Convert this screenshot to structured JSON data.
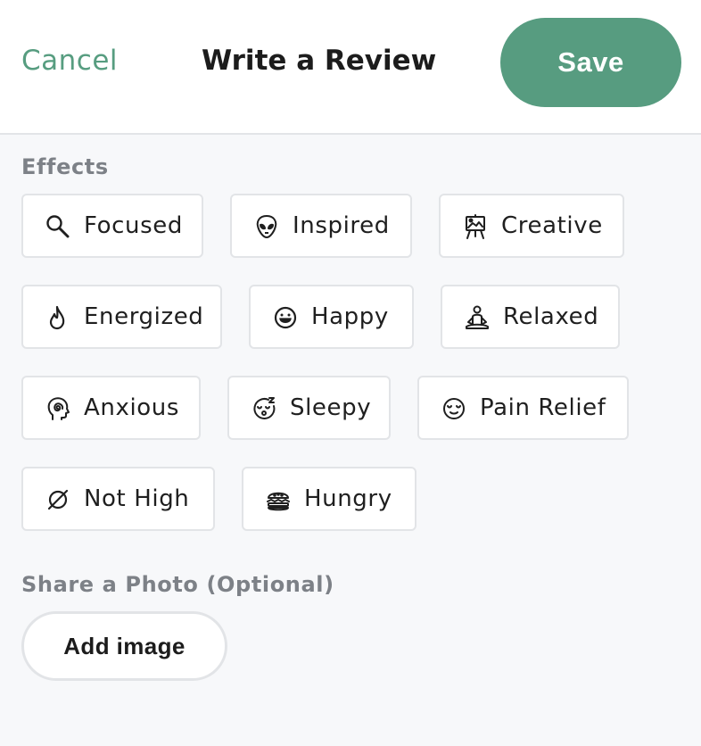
{
  "header": {
    "cancel_label": "Cancel",
    "title": "Write a Review",
    "save_label": "Save"
  },
  "effects": {
    "label": "Effects",
    "items": [
      {
        "label": "Focused",
        "icon": "magnifier-icon"
      },
      {
        "label": "Inspired",
        "icon": "alien-icon"
      },
      {
        "label": "Creative",
        "icon": "easel-icon"
      },
      {
        "label": "Energized",
        "icon": "flame-icon"
      },
      {
        "label": "Happy",
        "icon": "smiley-icon"
      },
      {
        "label": "Relaxed",
        "icon": "meditation-icon"
      },
      {
        "label": "Anxious",
        "icon": "head-spiral-icon"
      },
      {
        "label": "Sleepy",
        "icon": "sleepy-face-icon"
      },
      {
        "label": "Pain Relief",
        "icon": "relieved-face-icon"
      },
      {
        "label": "Not High",
        "icon": "empty-set-icon"
      },
      {
        "label": "Hungry",
        "icon": "burger-icon"
      }
    ]
  },
  "photo": {
    "label": "Share a Photo (Optional)",
    "add_image_label": "Add image"
  },
  "colors": {
    "accent": "#579c80",
    "muted_label": "#7d8187",
    "chip_border": "#e2e4e7",
    "background": "#f7f8fa"
  }
}
